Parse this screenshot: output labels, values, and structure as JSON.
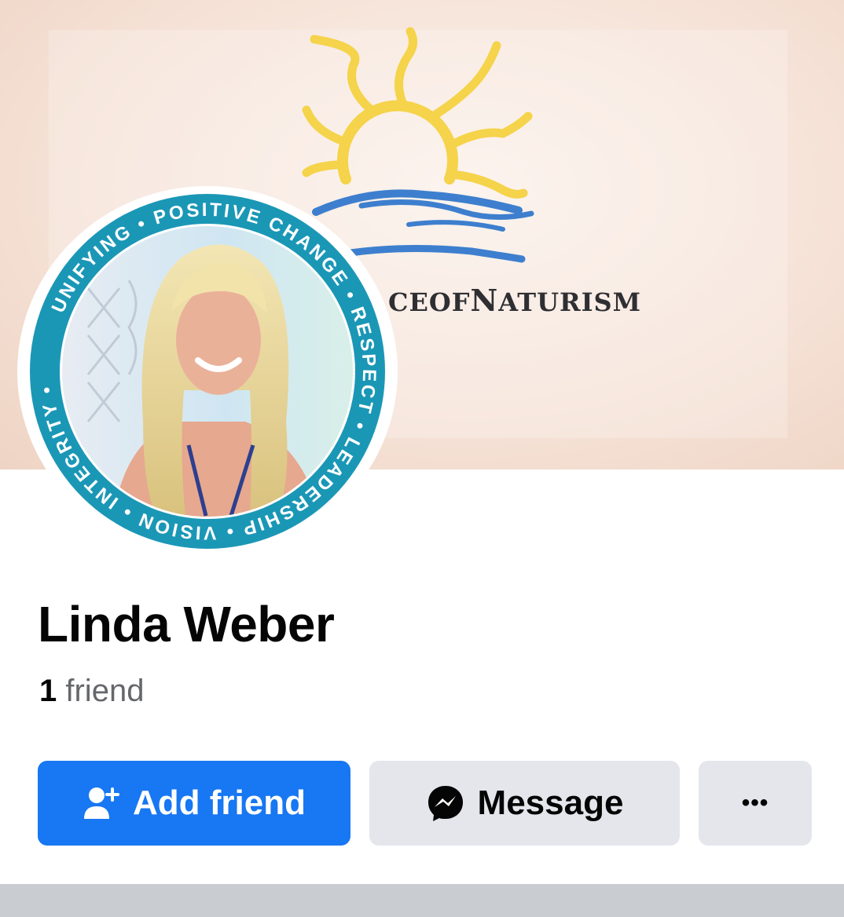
{
  "cover": {
    "brand_text_small": "CEOF",
    "brand_text_cap": "N",
    "brand_text_rest": "ATURISM",
    "sun_color": "#f5d34a",
    "wave_color": "#3d7fce"
  },
  "avatar": {
    "ring_color": "#1b97b6",
    "ring_words": [
      "POSITIVE CHANGE",
      "RESPECT",
      "LEADERSHIP",
      "VISION",
      "INTEGRITY",
      "UNIFYING"
    ]
  },
  "profile": {
    "name": "Linda Weber",
    "friend_count": "1",
    "friend_label": "friend"
  },
  "actions": {
    "add_friend_label": "Add friend",
    "message_label": "Message",
    "more_label": "•••",
    "primary_color": "#1877f2",
    "secondary_color": "#e4e6eb"
  },
  "icons": {
    "add_friend": "add-person-icon",
    "message": "messenger-icon",
    "more": "more-dots-icon"
  }
}
